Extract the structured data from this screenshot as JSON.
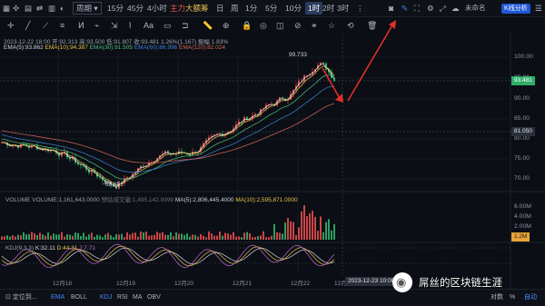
{
  "toolbar": {
    "symbol_icon": "grid-icon",
    "periods": [
      "周期",
      "15分",
      "45分",
      "4小时",
      "日",
      "周",
      "1分",
      "5分",
      "10分",
      "30分",
      "1时",
      "2时",
      "3时"
    ],
    "periods_positions_note": "",
    "indicators": {
      "main": "主力",
      "big": "大额",
      "chip": "筹"
    },
    "user_label": "未命名",
    "kline_label": "K线分析"
  },
  "header_info": {
    "ohlc": "2023-12-22 18:00  开:92.313  高:93.500  低:91.807  收:93.481  1.26%(1.167)  振幅 1.83%",
    "ema": {
      "e5": "EMA(5):93.862",
      "e10": "EMA(10):94.387",
      "e30": "EMA(30):91.505",
      "e60": "EMA(60):86.996",
      "e120": "EMA(120):82.024"
    }
  },
  "price_axis": {
    "labels": [
      "100.00",
      "95.00",
      "90.00",
      "85.00",
      "80.00",
      "75.00",
      "70.00"
    ],
    "last_price": "93.481",
    "cross_price": "81.050",
    "high_label": "99.733",
    "low_label": "66.851"
  },
  "volume": {
    "label": "VOLUME",
    "value": "VOLUME:1,161,643.0000",
    "predict": "预估成交量:1,495,142.9399",
    "ma5": "MA(5):2,806,445.4000",
    "ma10": "MA(10):2,595,871.0000",
    "axis": [
      "6.00M",
      "4.00M",
      "2.00M"
    ],
    "current_tag": "1.2M"
  },
  "kdj": {
    "label": "KDJ(9,3,3)",
    "k": "K:32.11",
    "d": "D:44.31",
    "j": "J:7.71"
  },
  "dates": [
    "12月18",
    "12月19",
    "12月20",
    "12月21",
    "12月22",
    "12月"
  ],
  "cursor_time": "2023-12-23 10:00",
  "bottom_bar": {
    "items": [
      "定位到...",
      "EMA",
      "BOLL",
      "KDJ",
      "RSI",
      "MA",
      "OBV"
    ],
    "right_items": [
      "对数",
      "%",
      "自动"
    ]
  },
  "watermark": "屌丝的区块链生涯",
  "colors": {
    "up": "#e04b4b",
    "down": "#2fae6a",
    "ema5": "#e8e8e8",
    "ema10": "#e8c34a",
    "ema30": "#4ec27e",
    "ema60": "#3f82d6",
    "ema120": "#d4685b",
    "arrow": "#e0302a"
  }
}
